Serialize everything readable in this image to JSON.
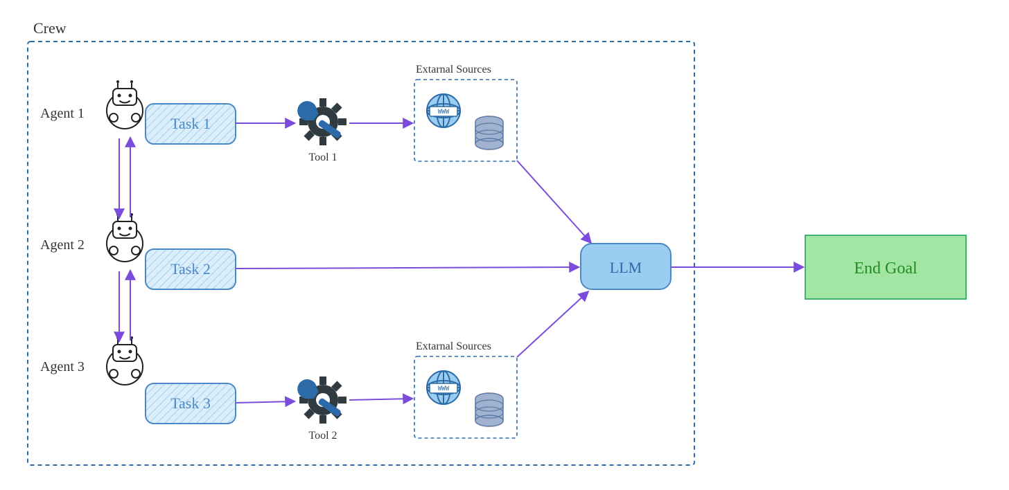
{
  "crew_label": "Crew",
  "agents": [
    {
      "label": "Agent 1"
    },
    {
      "label": "Agent 2"
    },
    {
      "label": "Agent 3"
    }
  ],
  "tasks": [
    {
      "label": "Task 1"
    },
    {
      "label": "Task 2"
    },
    {
      "label": "Task 3"
    }
  ],
  "tools": [
    {
      "label": "Tool 1"
    },
    {
      "label": "Tool 2"
    }
  ],
  "external_sources_label": "Extarnal Sources",
  "www_label": "WWW",
  "llm_label": "LLM",
  "goal_label": "End Goal",
  "colors": {
    "crew_border": "#2d6aa8",
    "task_fill": "#dbeefb",
    "task_stroke": "#4a89c7",
    "arrow": "#7b4cdb",
    "llm_fill": "#9bcdf0",
    "llm_stroke": "#4a89c7",
    "goal_fill": "#a3e6a3",
    "goal_stroke": "#3cb371",
    "gear": "#2f3b40",
    "wrench": "#2d6aa8",
    "globe": "#4a89c7",
    "db": "#7d96bd"
  }
}
